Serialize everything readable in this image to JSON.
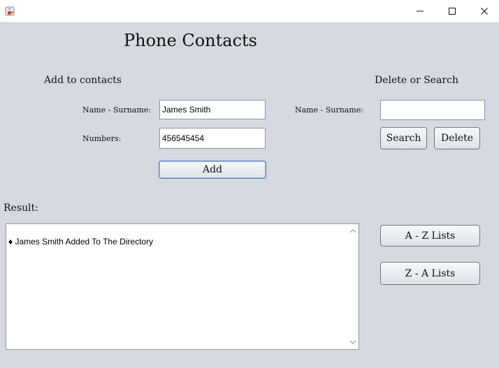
{
  "window": {
    "icon": "java-cup-icon",
    "controls": [
      "minimize-icon",
      "maximize-icon",
      "close-icon"
    ]
  },
  "app_title": "Phone Contacts",
  "add_section": {
    "heading": "Add to contacts",
    "name_label": "Name - Surname:",
    "name_value": "James Smith",
    "numbers_label": "Numbers:",
    "numbers_value": "456545454",
    "add_button": "Add"
  },
  "delete_section": {
    "heading": "Delete or Search",
    "name_label": "Name - Surname:",
    "name_value": "",
    "search_button": "Search",
    "delete_button": "Delete"
  },
  "result": {
    "label": "Result:",
    "text": "♦ James Smith Added To The Directory"
  },
  "list_buttons": {
    "az": "A - Z Lists",
    "za": "Z - A Lists"
  }
}
